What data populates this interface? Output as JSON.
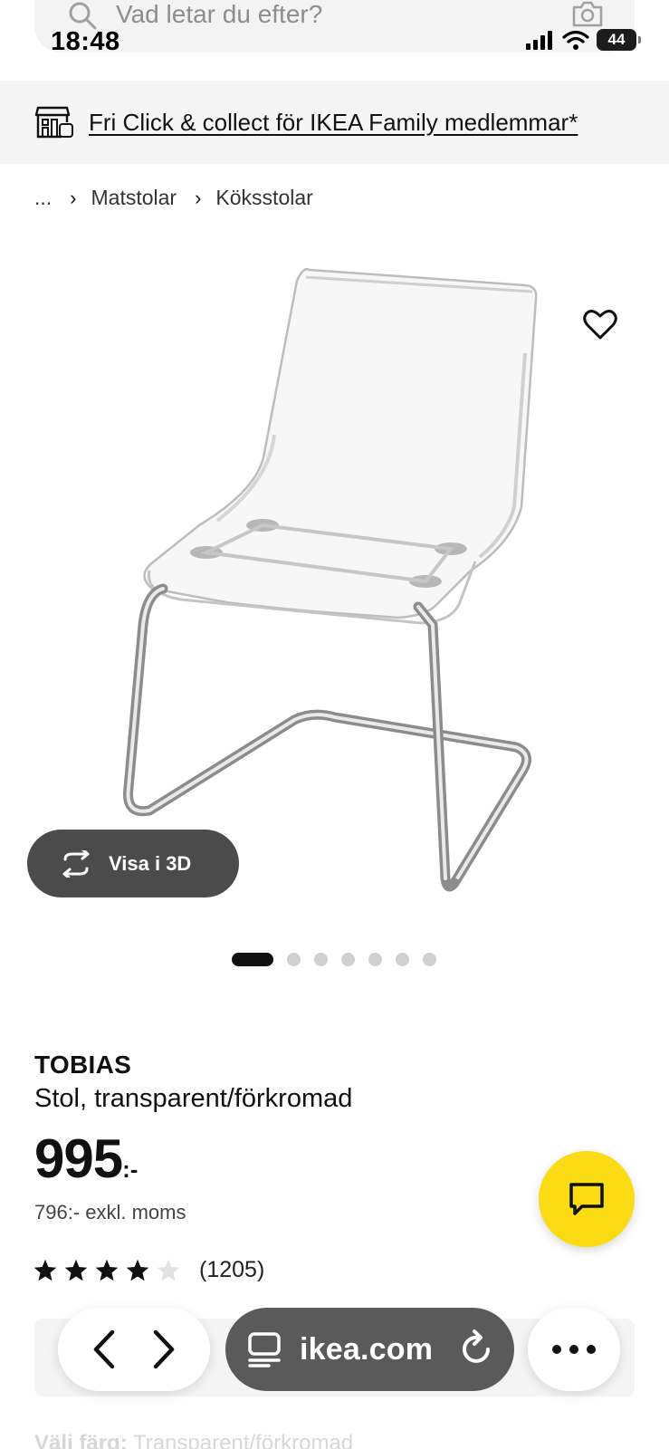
{
  "status_bar": {
    "time": "18:48",
    "battery": "44"
  },
  "search": {
    "placeholder": "Vad letar du efter?",
    "icon": "search-icon",
    "camera_icon": "camera-icon"
  },
  "banner": {
    "text": "Fri Click & collect för IKEA Family medlemmar*",
    "icon": "store-icon"
  },
  "breadcrumb": {
    "items": [
      "...",
      "Matstolar",
      "Köksstolar"
    ]
  },
  "gallery": {
    "view_3d_label": "Visa i 3D",
    "image_count": 7,
    "active_index": 0
  },
  "product": {
    "name": "TOBIAS",
    "description": "Stol, transparent/förkromad",
    "price": "995",
    "price_suffix": ":-",
    "price_ex_vat": "796:- exkl. moms",
    "rating_stars": 4,
    "rating_max": 5,
    "review_count": "(1205)"
  },
  "faded": {
    "choose_color_label": "Välj färg:",
    "choose_color_value": "Transparent/förkromad"
  },
  "browser": {
    "url": "ikea.com"
  },
  "colors": {
    "accent_yellow": "#fadb14",
    "url_pill": "#5a5a5a",
    "view3d_pill": "#4b4b4b"
  }
}
